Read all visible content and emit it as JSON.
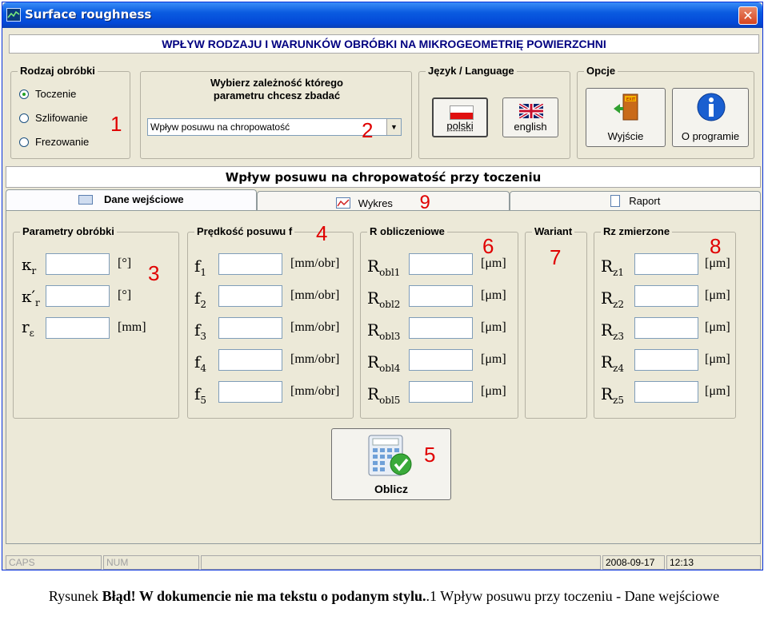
{
  "window": {
    "title": "Surface roughness",
    "close": "✕"
  },
  "banner": "WPŁYW RODZAJU I WARUNKÓW OBRÓBKI NA MIKROGEOMETRIĘ POWIERZCHNI",
  "machining": {
    "title": "Rodzaj obróbki",
    "options": [
      "Toczenie",
      "Szlifowanie",
      "Frezowanie"
    ],
    "selected": "Toczenie",
    "number": "1"
  },
  "param_select": {
    "title": "Wybierz zależność którego parametru chcesz zbadać",
    "value": "Wpływ posuwu na chropowatość",
    "number": "2"
  },
  "language": {
    "title": "Język / Language",
    "polski": "polski",
    "english": "english"
  },
  "options": {
    "title": "Opcje",
    "exit": "Wyjście",
    "about": "O programie"
  },
  "info_bar": "Wpływ posuwu na chropowatość przy toczeniu",
  "tabs": [
    {
      "label": "Dane wejściowe",
      "active": true
    },
    {
      "label": "Wykres",
      "number": "9"
    },
    {
      "label": "Raport"
    }
  ],
  "params": {
    "title": "Parametry obróbki",
    "number": "3",
    "rows": [
      {
        "sym": "κ",
        "sub": "r",
        "unit": "[°]"
      },
      {
        "sym": "κ′",
        "sub": "r",
        "unit": "[°]"
      },
      {
        "sym": "r",
        "sub": "ε",
        "unit": "[mm]"
      }
    ]
  },
  "feed": {
    "title": "Prędkość posuwu f",
    "number": "4",
    "rows": [
      {
        "sym": "f",
        "sub": "1",
        "unit": "[mm/obr]"
      },
      {
        "sym": "f",
        "sub": "2",
        "unit": "[mm/obr]"
      },
      {
        "sym": "f",
        "sub": "3",
        "unit": "[mm/obr]"
      },
      {
        "sym": "f",
        "sub": "4",
        "unit": "[mm/obr]"
      },
      {
        "sym": "f",
        "sub": "5",
        "unit": "[mm/obr]"
      }
    ]
  },
  "calc": {
    "title": "R obliczeniowe",
    "number": "6",
    "rows": [
      {
        "sym": "R",
        "sub": "obl1",
        "unit": "[μm]"
      },
      {
        "sym": "R",
        "sub": "obl2",
        "unit": "[μm]"
      },
      {
        "sym": "R",
        "sub": "obl3",
        "unit": "[μm]"
      },
      {
        "sym": "R",
        "sub": "obl4",
        "unit": "[μm]"
      },
      {
        "sym": "R",
        "sub": "obl5",
        "unit": "[μm]"
      }
    ]
  },
  "variant": {
    "title": "Wariant",
    "number": "7"
  },
  "measured": {
    "title": "Rz zmierzone",
    "number": "8",
    "rows": [
      {
        "sym": "R",
        "sub": "z1",
        "unit": "[μm]"
      },
      {
        "sym": "R",
        "sub": "z2",
        "unit": "[μm]"
      },
      {
        "sym": "R",
        "sub": "z3",
        "unit": "[μm]"
      },
      {
        "sym": "R",
        "sub": "z4",
        "unit": "[μm]"
      },
      {
        "sym": "R",
        "sub": "z5",
        "unit": "[μm]"
      }
    ]
  },
  "compute": {
    "label": "Oblicz",
    "number": "5"
  },
  "status": {
    "caps": "CAPS",
    "num": "NUM",
    "date": "2008-09-17",
    "time": "12:13"
  },
  "caption": {
    "prefix": "Rysunek ",
    "error": "Błąd! W dokumencie nie ma tekstu o podanym stylu.",
    "suffix": ".1 Wpływ posuwu przy toczeniu - Dane wejściowe"
  },
  "colors": {
    "title_bar": "#0a5be0",
    "banner_text": "#000080",
    "annotation": "#e00000",
    "face": "#ece9d8"
  }
}
